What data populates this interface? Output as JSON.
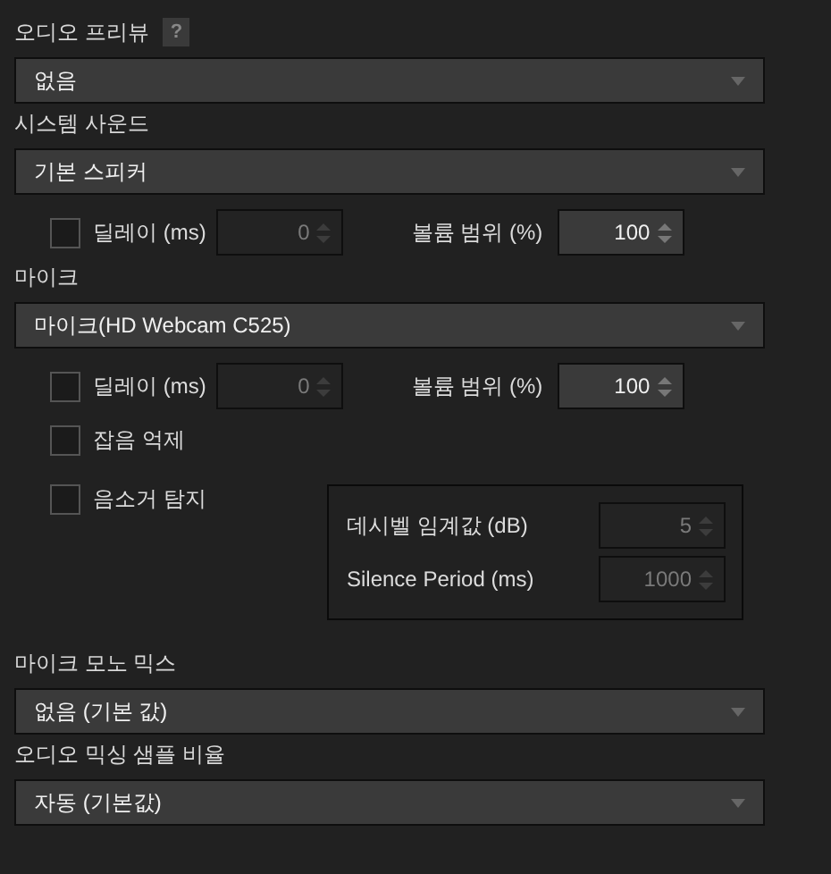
{
  "rows": [
    {
      "kind": "heading",
      "text": "오디오 프리뷰",
      "help": "?"
    },
    {
      "kind": "dropdown",
      "value": "없음"
    },
    {
      "kind": "heading",
      "text": "시스템 사운드"
    },
    {
      "kind": "dropdown",
      "value": "기본 스피커"
    },
    {
      "kind": "delay",
      "checked": false,
      "label": "딜레이 (ms)",
      "value": "0",
      "disabled": true,
      "volume_label": "볼륨 범위 (%)",
      "volume_value": "100"
    },
    {
      "kind": "heading",
      "text": "마이크"
    },
    {
      "kind": "dropdown",
      "value": "마이크(HD Webcam C525)"
    },
    {
      "kind": "delay",
      "checked": false,
      "label": "딜레이 (ms)",
      "value": "0",
      "disabled": true,
      "volume_label": "볼륨 범위 (%)",
      "volume_value": "100"
    },
    {
      "kind": "checkbox",
      "label": "잡음 억제",
      "checked": false
    },
    {
      "kind": "group",
      "label": "음소거 탐지",
      "checked": false,
      "fields": [
        {
          "label": "데시벨 임계값 (dB)",
          "value": "5",
          "disabled": true
        },
        {
          "label": "Silence Period (ms)",
          "value": "1000",
          "disabled": true
        }
      ]
    },
    {
      "kind": "heading",
      "text": "마이크 모노 믹스"
    },
    {
      "kind": "dropdown",
      "value": "없음 (기본 값)"
    },
    {
      "kind": "heading",
      "text": "오디오 믹싱 샘플 비율"
    },
    {
      "kind": "dropdown",
      "value": "자동 (기본값)"
    }
  ]
}
